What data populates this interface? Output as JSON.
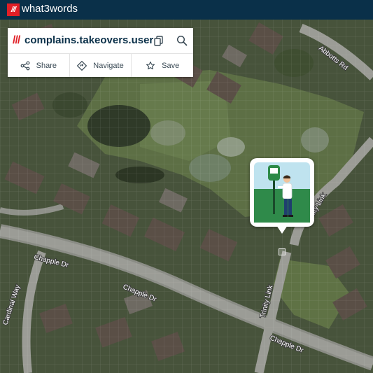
{
  "app": {
    "logo_glyph": "///",
    "brand_name": "what3words"
  },
  "location_card": {
    "slashes": "///",
    "address": "complains.takeovers.user",
    "copy_icon": "copy-icon",
    "search_icon": "search-icon",
    "actions": [
      {
        "label": "Share",
        "icon": "share-icon"
      },
      {
        "label": "Navigate",
        "icon": "navigate-icon"
      },
      {
        "label": "Save",
        "icon": "star-icon"
      }
    ]
  },
  "map": {
    "streets": [
      {
        "name": "Abbotts Rd"
      },
      {
        "name": "Chapple Dr"
      },
      {
        "name": "Chapple Dr"
      },
      {
        "name": "Chapple Dr"
      },
      {
        "name": "Cardinal Way"
      },
      {
        "name": "Trinity Link"
      },
      {
        "name": "Trinity Link"
      }
    ]
  },
  "colors": {
    "topbar": "#0a3049",
    "brand_red": "#e11f26",
    "address_text": "#0a3049"
  }
}
